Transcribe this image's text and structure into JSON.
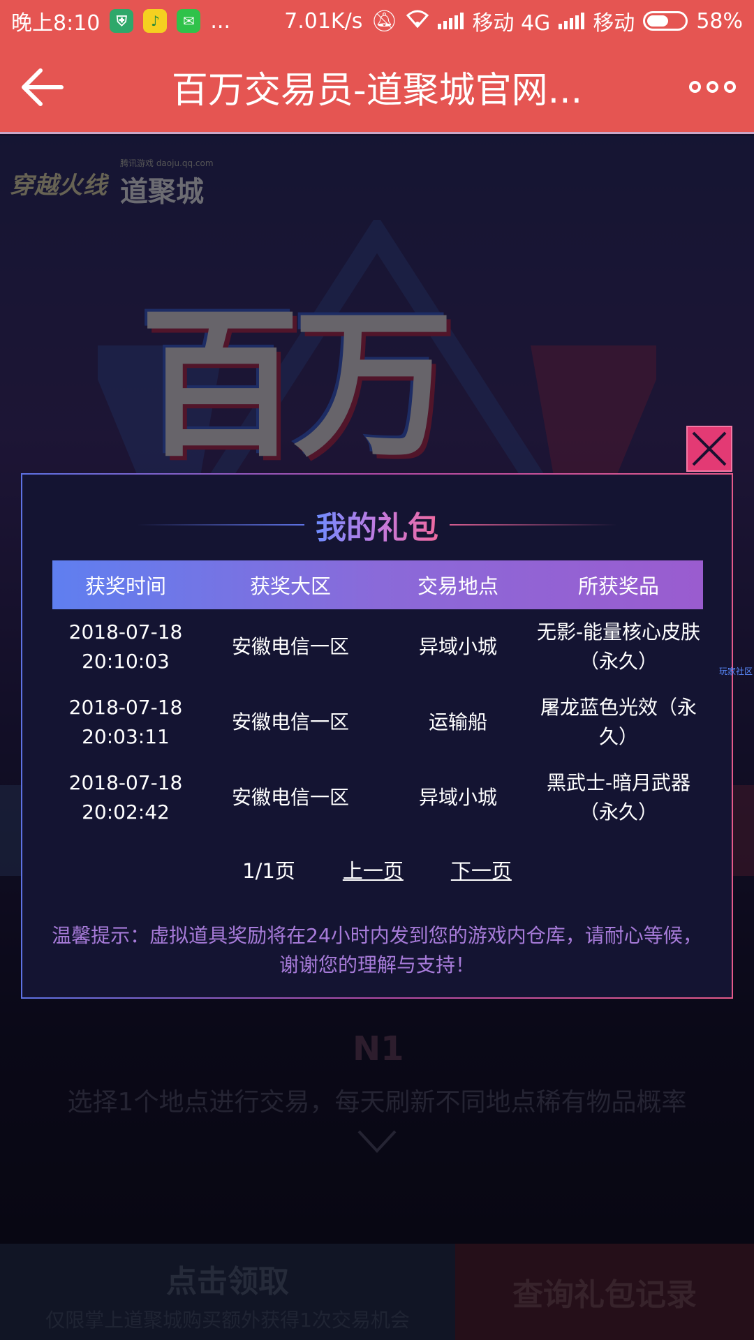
{
  "status_bar": {
    "time": "晚上8:10",
    "more": "...",
    "speed": "7.01K/s",
    "carrier1": "移动 4G",
    "carrier2": "移动",
    "battery": "58%",
    "battery_level": 0.58
  },
  "title_bar": {
    "title": "百万交易员-道聚城官网..."
  },
  "background": {
    "logo_cf": "穿越火线",
    "logo_daoju_small": "腾讯游戏 daoju.qq.com",
    "logo_daoju": "道聚城",
    "hero_title": "百万",
    "caption": "选择1个地点进行交易，每天刷新不同地点稀有物品概率",
    "n1": "N1",
    "claim_button": "点击领取",
    "claim_sub": "仅限掌上道聚城购买额外获得1次交易机会",
    "record_button": "查询礼包记录"
  },
  "modal": {
    "title": "我的礼包",
    "headers": [
      "获奖时间",
      "获奖大区",
      "交易地点",
      "所获奖品"
    ],
    "rows": [
      {
        "date": "2018-07-18",
        "time": "20:10:03",
        "region": "安徽电信一区",
        "place": "异域小城",
        "prize_l1": "无影-能量核心皮肤",
        "prize_l2": "（永久）"
      },
      {
        "date": "2018-07-18",
        "time": "20:03:11",
        "region": "安徽电信一区",
        "place": "运输船",
        "prize_l1": "屠龙蓝色光效（永",
        "prize_l2": "久）"
      },
      {
        "date": "2018-07-18",
        "time": "20:02:42",
        "region": "安徽电信一区",
        "place": "异域小城",
        "prize_l1": "黑武士-暗月武器",
        "prize_l2": "（永久）"
      }
    ],
    "page_info": "1/1页",
    "prev": "上一页",
    "next": "下一页",
    "tip_l1": "温馨提示：虚拟道具奖励将在24小时内发到您的游戏内仓库，请耐心等候，",
    "tip_l2": "谢谢您的理解与支持！",
    "side_tag": "玩家社区"
  }
}
